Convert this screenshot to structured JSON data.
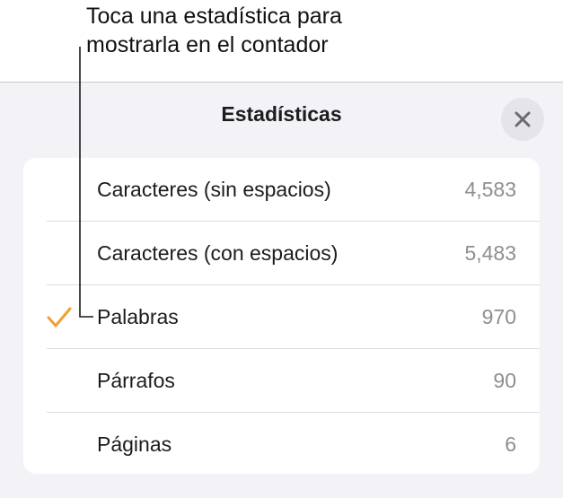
{
  "callout": {
    "line1": "Toca una estadística para",
    "line2": "mostrarla en el contador"
  },
  "panel": {
    "title": "Estadísticas",
    "close_icon": "close-icon"
  },
  "stats": [
    {
      "label": "Caracteres (sin espacios)",
      "value": "4,583",
      "selected": false
    },
    {
      "label": "Caracteres (con espacios)",
      "value": "5,483",
      "selected": false
    },
    {
      "label": "Palabras",
      "value": "970",
      "selected": true
    },
    {
      "label": "Párrafos",
      "value": "90",
      "selected": false
    },
    {
      "label": "Páginas",
      "value": "6",
      "selected": false
    }
  ],
  "colors": {
    "accent": "#f0a030",
    "panel_bg": "#f2f2f7",
    "value_text": "#8e8e93"
  }
}
